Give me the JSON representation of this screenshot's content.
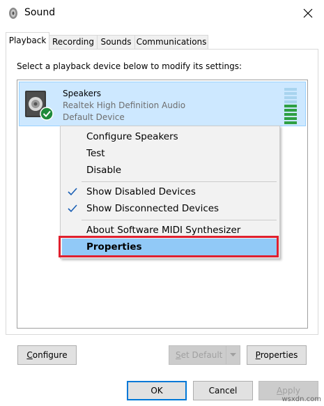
{
  "window": {
    "title": "Sound",
    "close_glyph": "✕"
  },
  "tabs": [
    {
      "label": "Playback",
      "active": true
    },
    {
      "label": "Recording",
      "active": false
    },
    {
      "label": "Sounds",
      "active": false
    },
    {
      "label": "Communications",
      "active": false
    }
  ],
  "panel": {
    "instruction": "Select a playback device below to modify its settings:"
  },
  "device": {
    "name": "Speakers",
    "driver": "Realtek High Definition Audio",
    "status": "Default Device",
    "level_fraction": 0.55,
    "icon": "speaker-icon",
    "badge_icon": "default-check-icon"
  },
  "context_menu": {
    "items": [
      {
        "label": "Configure Speakers",
        "checked": false
      },
      {
        "label": "Test",
        "checked": false
      },
      {
        "label": "Disable",
        "checked": false
      },
      {
        "label": "Show Disabled Devices",
        "checked": true
      },
      {
        "label": "Show Disconnected Devices",
        "checked": true
      },
      {
        "label": "About Software MIDI Synthesizer",
        "checked": false
      },
      {
        "label": "Properties",
        "checked": false,
        "highlighted": true
      }
    ]
  },
  "panel_buttons": {
    "configure": {
      "prefix": "",
      "accel": "C",
      "rest": "onfigure"
    },
    "set_default": {
      "prefix": "",
      "accel": "S",
      "rest": "et Default"
    },
    "properties": {
      "prefix": "",
      "accel": "P",
      "rest": "roperties"
    }
  },
  "dialog_buttons": {
    "ok": "OK",
    "cancel": "Cancel",
    "apply": {
      "accel": "A",
      "rest": "pply"
    }
  },
  "watermark": "wsxdn.com",
  "colors": {
    "selection": "#cde8ff",
    "menu_highlight": "#91c9f7",
    "annotation_red": "#e0202e",
    "accent": "#0078d7",
    "level_green": "#2ea043"
  }
}
